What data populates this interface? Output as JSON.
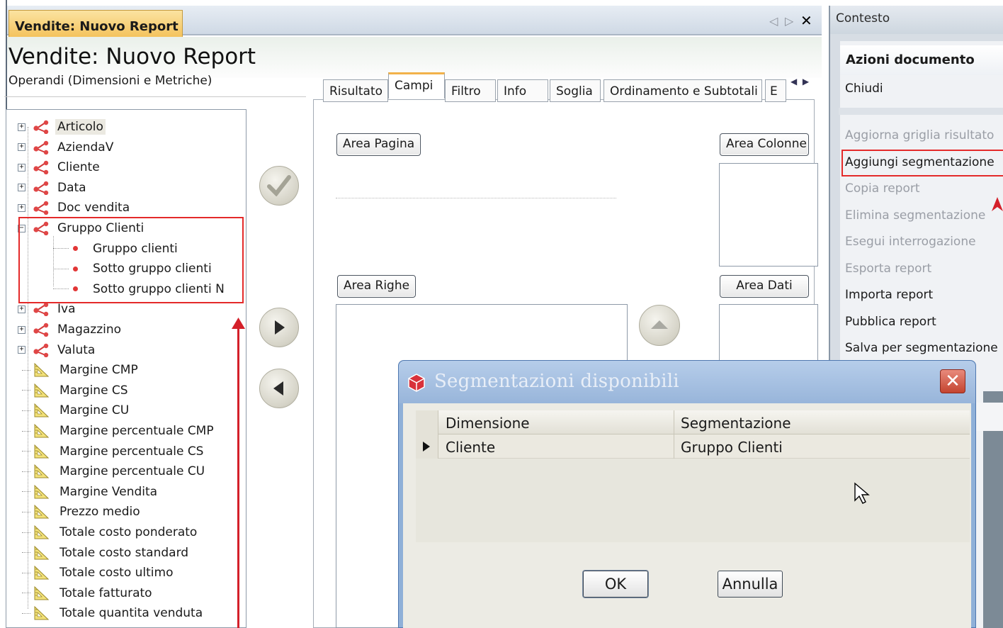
{
  "window": {
    "tab_label": "Vendite: Nuovo Report",
    "title": "Vendite: Nuovo Report"
  },
  "operands": {
    "label": "Operandi (Dimensioni e Metriche)",
    "dimensions": [
      "Articolo",
      "AziendaV",
      "Cliente",
      "Data",
      "Doc vendita",
      "Gruppo Clienti",
      "Iva",
      "Magazzino",
      "Valuta"
    ],
    "expanded_children": [
      "Gruppo clienti",
      "Sotto gruppo clienti",
      "Sotto gruppo clienti N"
    ],
    "metrics": [
      "Margine CMP",
      "Margine CS",
      "Margine CU",
      "Margine percentuale CMP",
      "Margine percentuale CS",
      "Margine percentuale CU",
      "Margine Vendita",
      "Prezzo medio",
      "Totale costo ponderato",
      "Totale costo standard",
      "Totale costo ultimo",
      "Totale fatturato",
      "Totale quantita venduta"
    ]
  },
  "tabs": [
    "Risultato",
    "Campi",
    "Filtro",
    "Info",
    "Soglia",
    "Ordinamento e Subtotali",
    "E"
  ],
  "active_tab": "Campi",
  "areas": {
    "pagina": "Area Pagina",
    "colonne": "Area Colonne",
    "righe": "Area Righe",
    "dati": "Area Dati"
  },
  "context": {
    "header": "Contesto",
    "section": "Azioni documento",
    "close": "Chiudi",
    "actions": [
      {
        "label": "Aggiorna griglia risultato",
        "enabled": false
      },
      {
        "label": "Aggiungi segmentazione",
        "enabled": true
      },
      {
        "label": "Copia report",
        "enabled": false
      },
      {
        "label": "Elimina segmentazione",
        "enabled": false
      },
      {
        "label": "Esegui interrogazione",
        "enabled": false
      },
      {
        "label": "Esporta report",
        "enabled": false
      },
      {
        "label": "Importa report",
        "enabled": true
      },
      {
        "label": "Pubblica report",
        "enabled": true
      },
      {
        "label": "Salva per segmentazione",
        "enabled": true
      }
    ]
  },
  "dialog": {
    "title": "Segmentazioni disponibili",
    "columns": [
      "Dimensione",
      "Segmentazione"
    ],
    "rows": [
      [
        "Cliente",
        "Gruppo Clienti"
      ]
    ],
    "ok": "OK",
    "cancel": "Annulla"
  },
  "colors": {
    "highlight_red": "#e42a2a",
    "tab_accent": "#f2b24a",
    "dialog_title": "#98b5da"
  },
  "icons": {
    "dimension": "dimension-node-icon",
    "metric": "ruler-triangle-icon",
    "confirm": "checkmark-icon",
    "add": "arrow-right-icon",
    "remove": "arrow-left-icon",
    "move_up": "arrow-up-icon"
  }
}
